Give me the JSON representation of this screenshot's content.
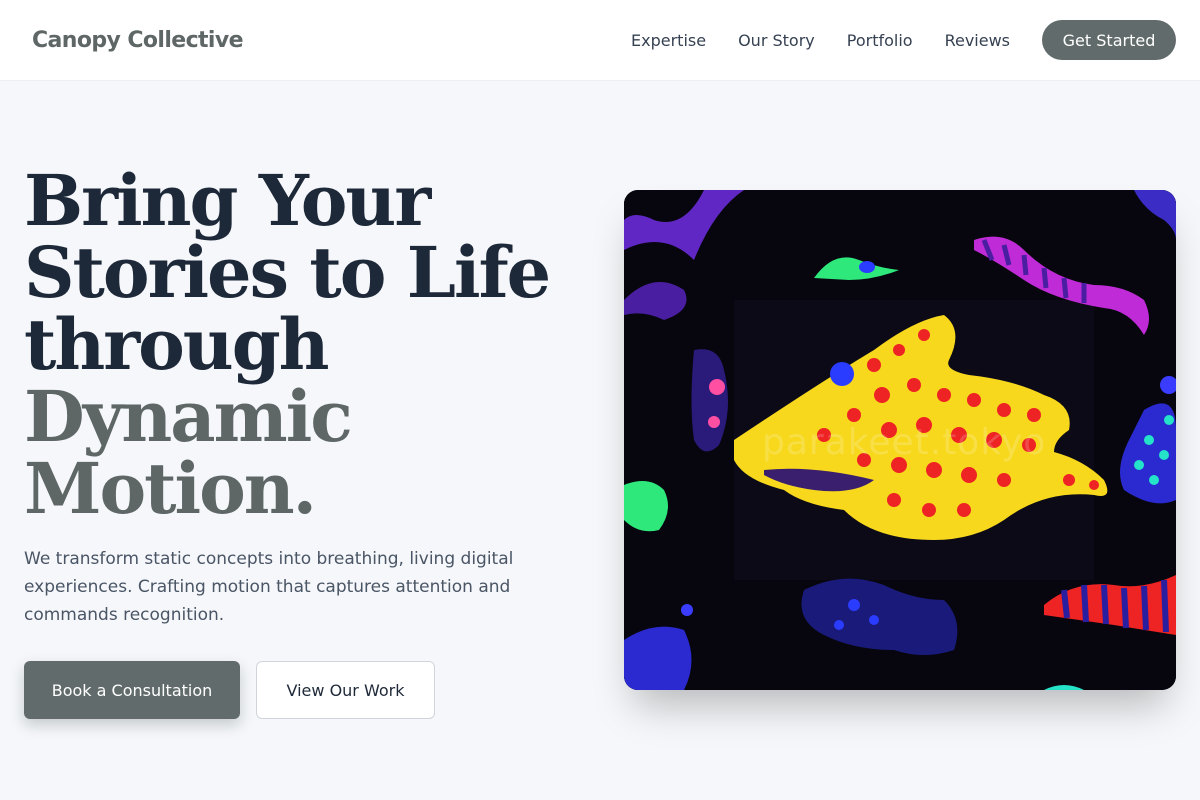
{
  "brand": {
    "name": "Canopy Collective"
  },
  "nav": {
    "links": [
      "Expertise",
      "Our Story",
      "Portfolio",
      "Reviews"
    ],
    "cta_label": "Get Started"
  },
  "hero": {
    "headline_dark": [
      "Bring Your",
      "Stories to Life",
      "through"
    ],
    "headline_accent": [
      "Dynamic",
      "Motion."
    ],
    "subtext": "We transform static concepts into breathing, living digital experiences. Crafting motion that captures attention and commands recognition.",
    "primary_button": "Book a Consultation",
    "secondary_button": "View Our Work",
    "image_watermark": "parakeet.tokyo"
  },
  "colors": {
    "accent": "#626b6b",
    "headline_dark": "#1d2838",
    "headline_accent": "#5e6666",
    "background": "#f5f7fa"
  }
}
